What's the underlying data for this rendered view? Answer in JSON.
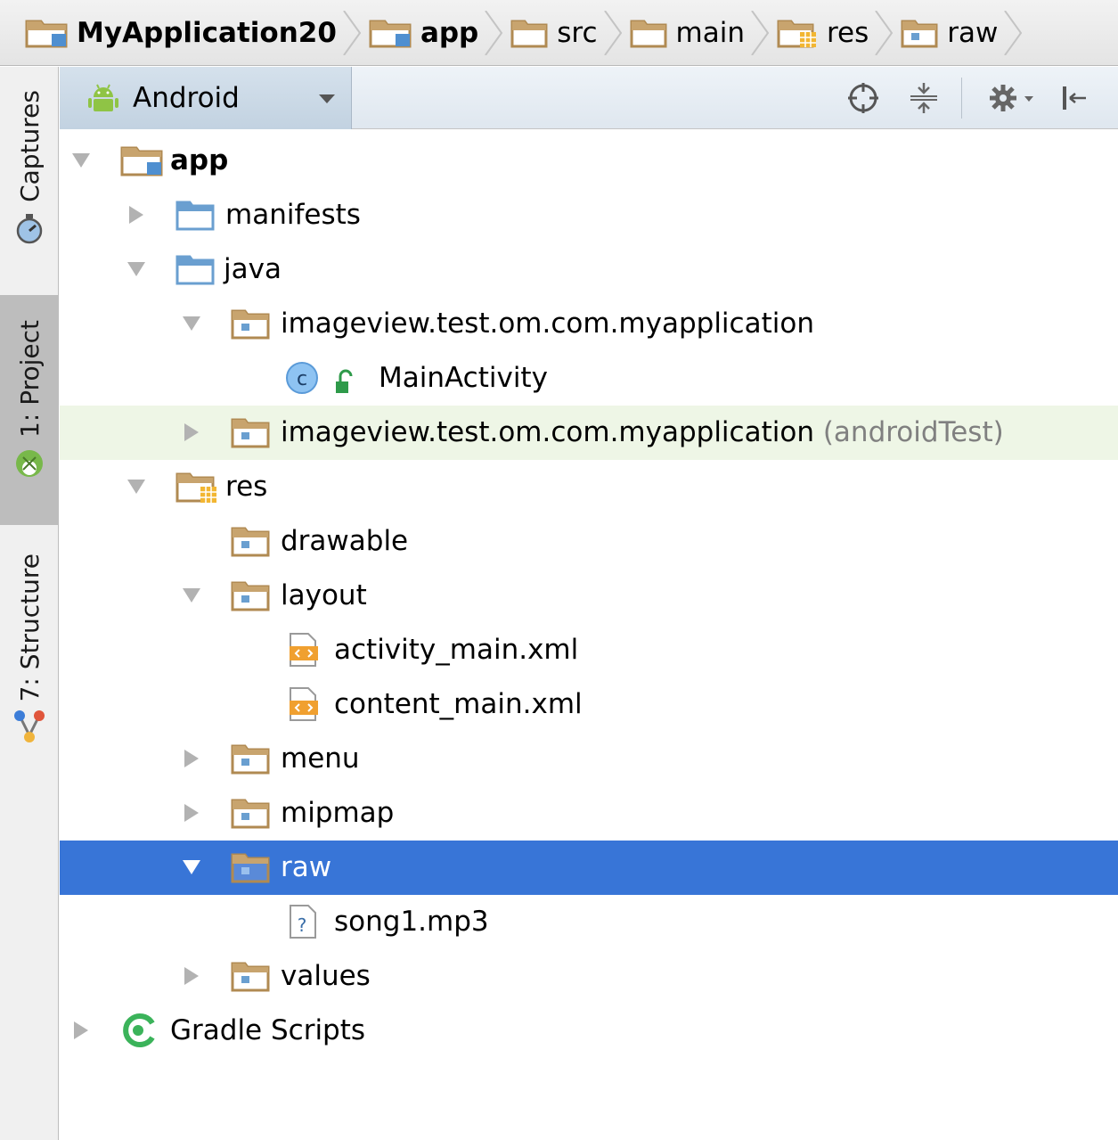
{
  "breadcrumb": [
    {
      "label": "MyApplication20",
      "icon": "module-folder-icon",
      "bold": true
    },
    {
      "label": "app",
      "icon": "module-folder-icon",
      "bold": true
    },
    {
      "label": "src",
      "icon": "folder-icon",
      "bold": false
    },
    {
      "label": "main",
      "icon": "folder-icon",
      "bold": false
    },
    {
      "label": "res",
      "icon": "resource-folder-icon",
      "bold": false
    },
    {
      "label": "raw",
      "icon": "package-folder-icon",
      "bold": false
    }
  ],
  "side_tabs": {
    "captures": "Captures",
    "project": "1: Project",
    "structure": "7: Structure"
  },
  "toolbar": {
    "view_mode": "Android"
  },
  "tree": {
    "app": "app",
    "manifests": "manifests",
    "java": "java",
    "pkg_main": "imageview.test.om.com.myapplication",
    "main_activity": "MainActivity",
    "pkg_test": "imageview.test.om.com.myapplication",
    "pkg_test_suffix": "(androidTest)",
    "res": "res",
    "drawable": "drawable",
    "layout": "layout",
    "activity_main": "activity_main.xml",
    "content_main": "content_main.xml",
    "menu": "menu",
    "mipmap": "mipmap",
    "raw": "raw",
    "song": "song1.mp3",
    "values": "values",
    "gradle": "Gradle Scripts"
  },
  "colors": {
    "selection": "#3875d7",
    "highlight_row": "#eef6e6",
    "folder_tan": "#c8a46e",
    "folder_blue": "#6a9fd0"
  }
}
